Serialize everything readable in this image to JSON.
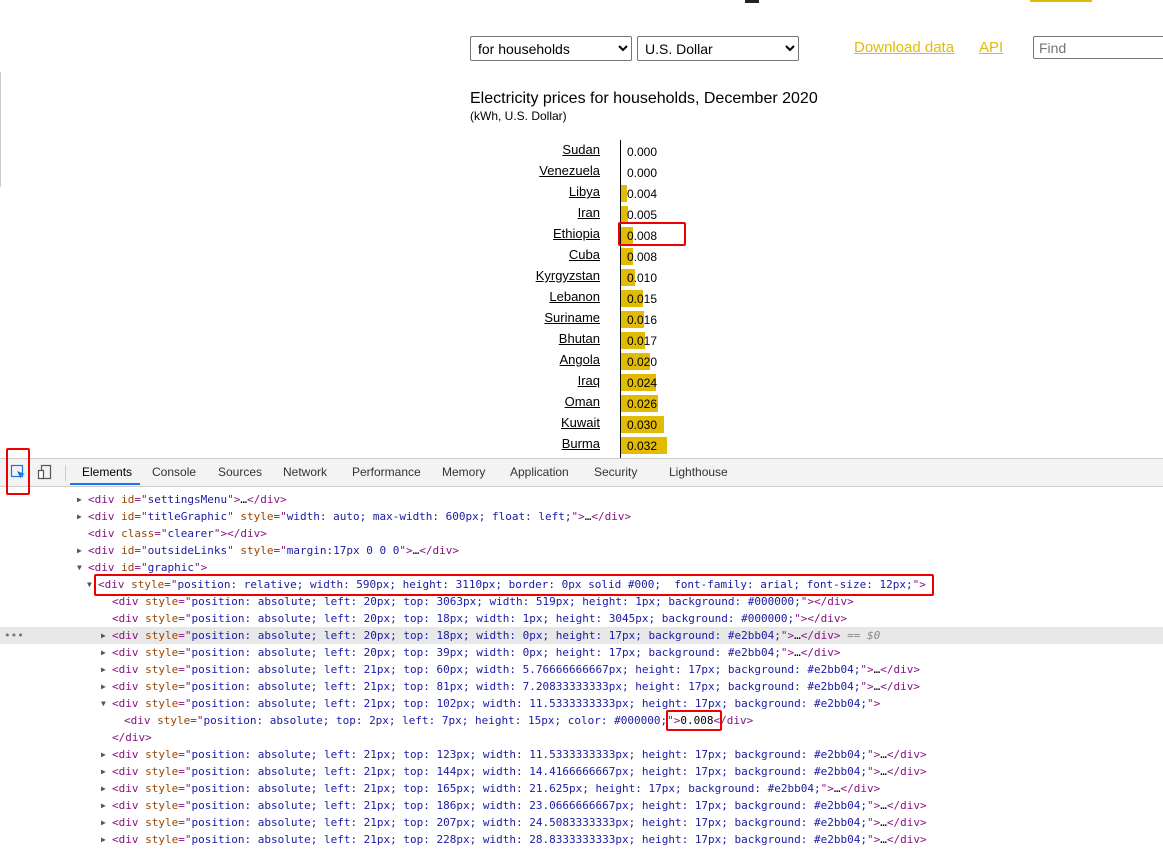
{
  "controls": {
    "type_select": "for households",
    "currency_select": "U.S. Dollar",
    "download_label": "Download data",
    "api_label": "API",
    "find_placeholder": "Find"
  },
  "chart": {
    "title": "Electricity prices for households, December 2020",
    "subtitle": "(kWh, U.S. Dollar)"
  },
  "chart_data": {
    "type": "bar",
    "orientation": "horizontal",
    "title": "Electricity prices for households, December 2020",
    "subtitle": "(kWh, U.S. Dollar)",
    "categories": [
      "Sudan",
      "Venezuela",
      "Libya",
      "Iran",
      "Ethiopia",
      "Cuba",
      "Kyrgyzstan",
      "Lebanon",
      "Suriname",
      "Bhutan",
      "Angola",
      "Iraq",
      "Oman",
      "Kuwait",
      "Burma"
    ],
    "values": [
      0.0,
      0.0,
      0.004,
      0.005,
      0.008,
      0.008,
      0.01,
      0.015,
      0.016,
      0.017,
      0.02,
      0.024,
      0.026,
      0.03,
      0.032
    ],
    "labels": [
      "0.000",
      "0.000",
      "0.004",
      "0.005",
      "0.008",
      "0.008",
      "0.010",
      "0.015",
      "0.016",
      "0.017",
      "0.020",
      "0.024",
      "0.026",
      "0.030",
      "0.032"
    ],
    "bar_color": "#e2bb04",
    "grid": false
  },
  "devtools": {
    "tabs": [
      "Elements",
      "Console",
      "Sources",
      "Network",
      "Performance",
      "Memory",
      "Application",
      "Security",
      "Lighthouse"
    ],
    "active_tab": "Elements",
    "selected_suffix": " == $0",
    "lines": [
      {
        "id": "settingsMenu",
        "text": "<div id=\"settingsMenu\">…</div>"
      },
      {
        "id": "titleGraphic",
        "text": "<div id=\"titleGraphic\" style=\"width: auto; max-width: 600px; float: left;\">…</div>"
      },
      {
        "id": "clearer",
        "text": "<div class=\"clearer\"></div>"
      },
      {
        "id": "outsideLinks",
        "text": "<div id=\"outsideLinks\" style=\"margin:17px 0 0 0\">…</div>"
      },
      {
        "id": "graphic",
        "text": "<div id=\"graphic\">"
      },
      {
        "id": "container",
        "text": "<div style=\"position: relative; width: 590px; height: 3110px; border: 0px solid #000;  font-family: arial; font-size: 12px;\">"
      },
      {
        "id": "l1",
        "text": "<div style=\"position: absolute; left: 20px; top: 3063px; width: 519px; height: 1px; background: #000000;\"></div>"
      },
      {
        "id": "l2",
        "text": "<div style=\"position: absolute; left: 20px; top: 18px; width: 1px; height: 3045px; background: #000000;\"></div>"
      },
      {
        "id": "l3",
        "text": "<div style=\"position: absolute; left: 20px; top: 18px; width: 0px; height: 17px; background: #e2bb04;\">…</div>"
      },
      {
        "id": "l4",
        "text": "<div style=\"position: absolute; left: 20px; top: 39px; width: 0px; height: 17px; background: #e2bb04;\">…</div>"
      },
      {
        "id": "l5",
        "text": "<div style=\"position: absolute; left: 21px; top: 60px; width: 5.76666666667px; height: 17px; background: #e2bb04;\">…</div>"
      },
      {
        "id": "l6",
        "text": "<div style=\"position: absolute; left: 21px; top: 81px; width: 7.20833333333px; height: 17px; background: #e2bb04;\">…</div>"
      },
      {
        "id": "l7",
        "text": "<div style=\"position: absolute; left: 21px; top: 102px; width: 11.5333333333px; height: 17px; background: #e2bb04;\">"
      },
      {
        "id": "l8",
        "text": "<div style=\"position: absolute; top: 2px; left: 7px; height: 15px; color: #000000;\">0.008</div>"
      },
      {
        "id": "l9",
        "text": "</div>"
      },
      {
        "id": "l10",
        "text": "<div style=\"position: absolute; left: 21px; top: 123px; width: 11.5333333333px; height: 17px; background: #e2bb04;\">…</div>"
      },
      {
        "id": "l11",
        "text": "<div style=\"position: absolute; left: 21px; top: 144px; width: 14.4166666667px; height: 17px; background: #e2bb04;\">…</div>"
      },
      {
        "id": "l12",
        "text": "<div style=\"position: absolute; left: 21px; top: 165px; width: 21.625px; height: 17px; background: #e2bb04;\">…</div>"
      },
      {
        "id": "l13",
        "text": "<div style=\"position: absolute; left: 21px; top: 186px; width: 23.0666666667px; height: 17px; background: #e2bb04;\">…</div>"
      },
      {
        "id": "l14",
        "text": "<div style=\"position: absolute; left: 21px; top: 207px; width: 24.5083333333px; height: 17px; background: #e2bb04;\">…</div>"
      },
      {
        "id": "l15",
        "text": "<div style=\"position: absolute; left: 21px; top: 228px; width: 28.8333333333px; height: 17px; background: #e2bb04;\">…</div>"
      }
    ]
  }
}
